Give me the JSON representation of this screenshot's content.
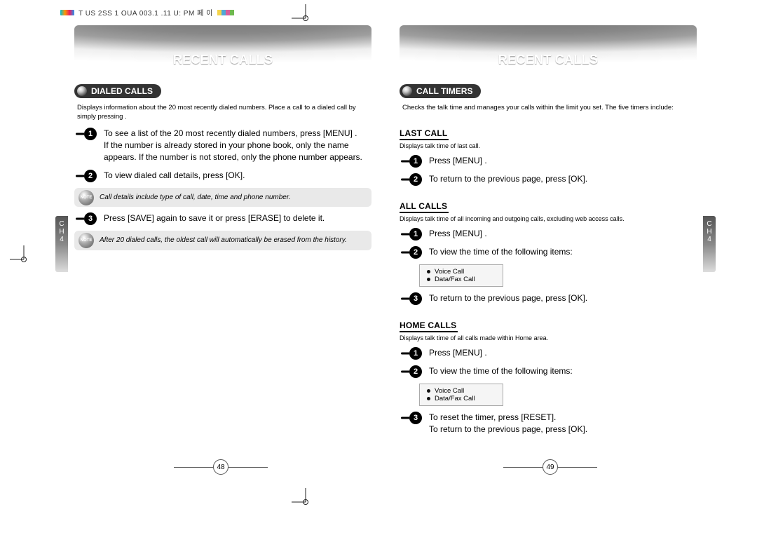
{
  "meta": {
    "header_text": "T    US 2SS 1  OUA    003.1  .11 U:     PM  페 이"
  },
  "sidetab_text": "C\nH\n4",
  "left": {
    "watermark_title": "RECENT CALLS",
    "section_title": "DIALED CALLS",
    "section_desc": "Displays information about the 20 most recently dialed numbers. Place a call to a dialed call by simply pressing        .",
    "steps": {
      "s1": "To see a list of the 20 most recently dialed numbers, press        [MENU]                .\nIf the number is already stored in your phone book, only the name appears. If the number is not stored, only the phone number appears.",
      "s2": "To view dialed call details, press        [OK].",
      "note1": "Call details include type of call, date, time and phone number.",
      "s3": "Press                [SAVE] again to save it or press        [ERASE] to delete it.",
      "note2": "After 20 dialed calls, the oldest call will automatically be erased from the history."
    },
    "page_number": "48"
  },
  "right": {
    "watermark_title": "RECENT CALLS",
    "section_title": "CALL TIMERS",
    "section_desc": "Checks the talk time and manages your calls within the limit you set. The five timers include:",
    "last_call": {
      "heading": "LAST CALL",
      "desc": "Displays talk time of last call.",
      "s1": "Press        [MENU]                        .",
      "s2": "To return to the previous page, press        [OK]."
    },
    "all_calls": {
      "heading": "ALL CALLS",
      "desc": "Displays talk time of all incoming and outgoing calls, excluding web access calls.",
      "s1": "Press        [MENU]                        .",
      "s2": "To view the time of the following items:",
      "list1": "Voice Call",
      "list2": "Data/Fax Call",
      "s3": "To return to the previous page, press        [OK]."
    },
    "home_calls": {
      "heading": "HOME CALLS",
      "desc": "Displays talk time of all calls made within Home area.",
      "s1": "Press        [MENU]                        .",
      "s2": "To view the time of the following items:",
      "list1": "Voice Call",
      "list2": "Data/Fax Call",
      "s3": "To reset the timer, press        [RESET].\nTo return to the previous page, press        [OK]."
    },
    "page_number": "49"
  }
}
